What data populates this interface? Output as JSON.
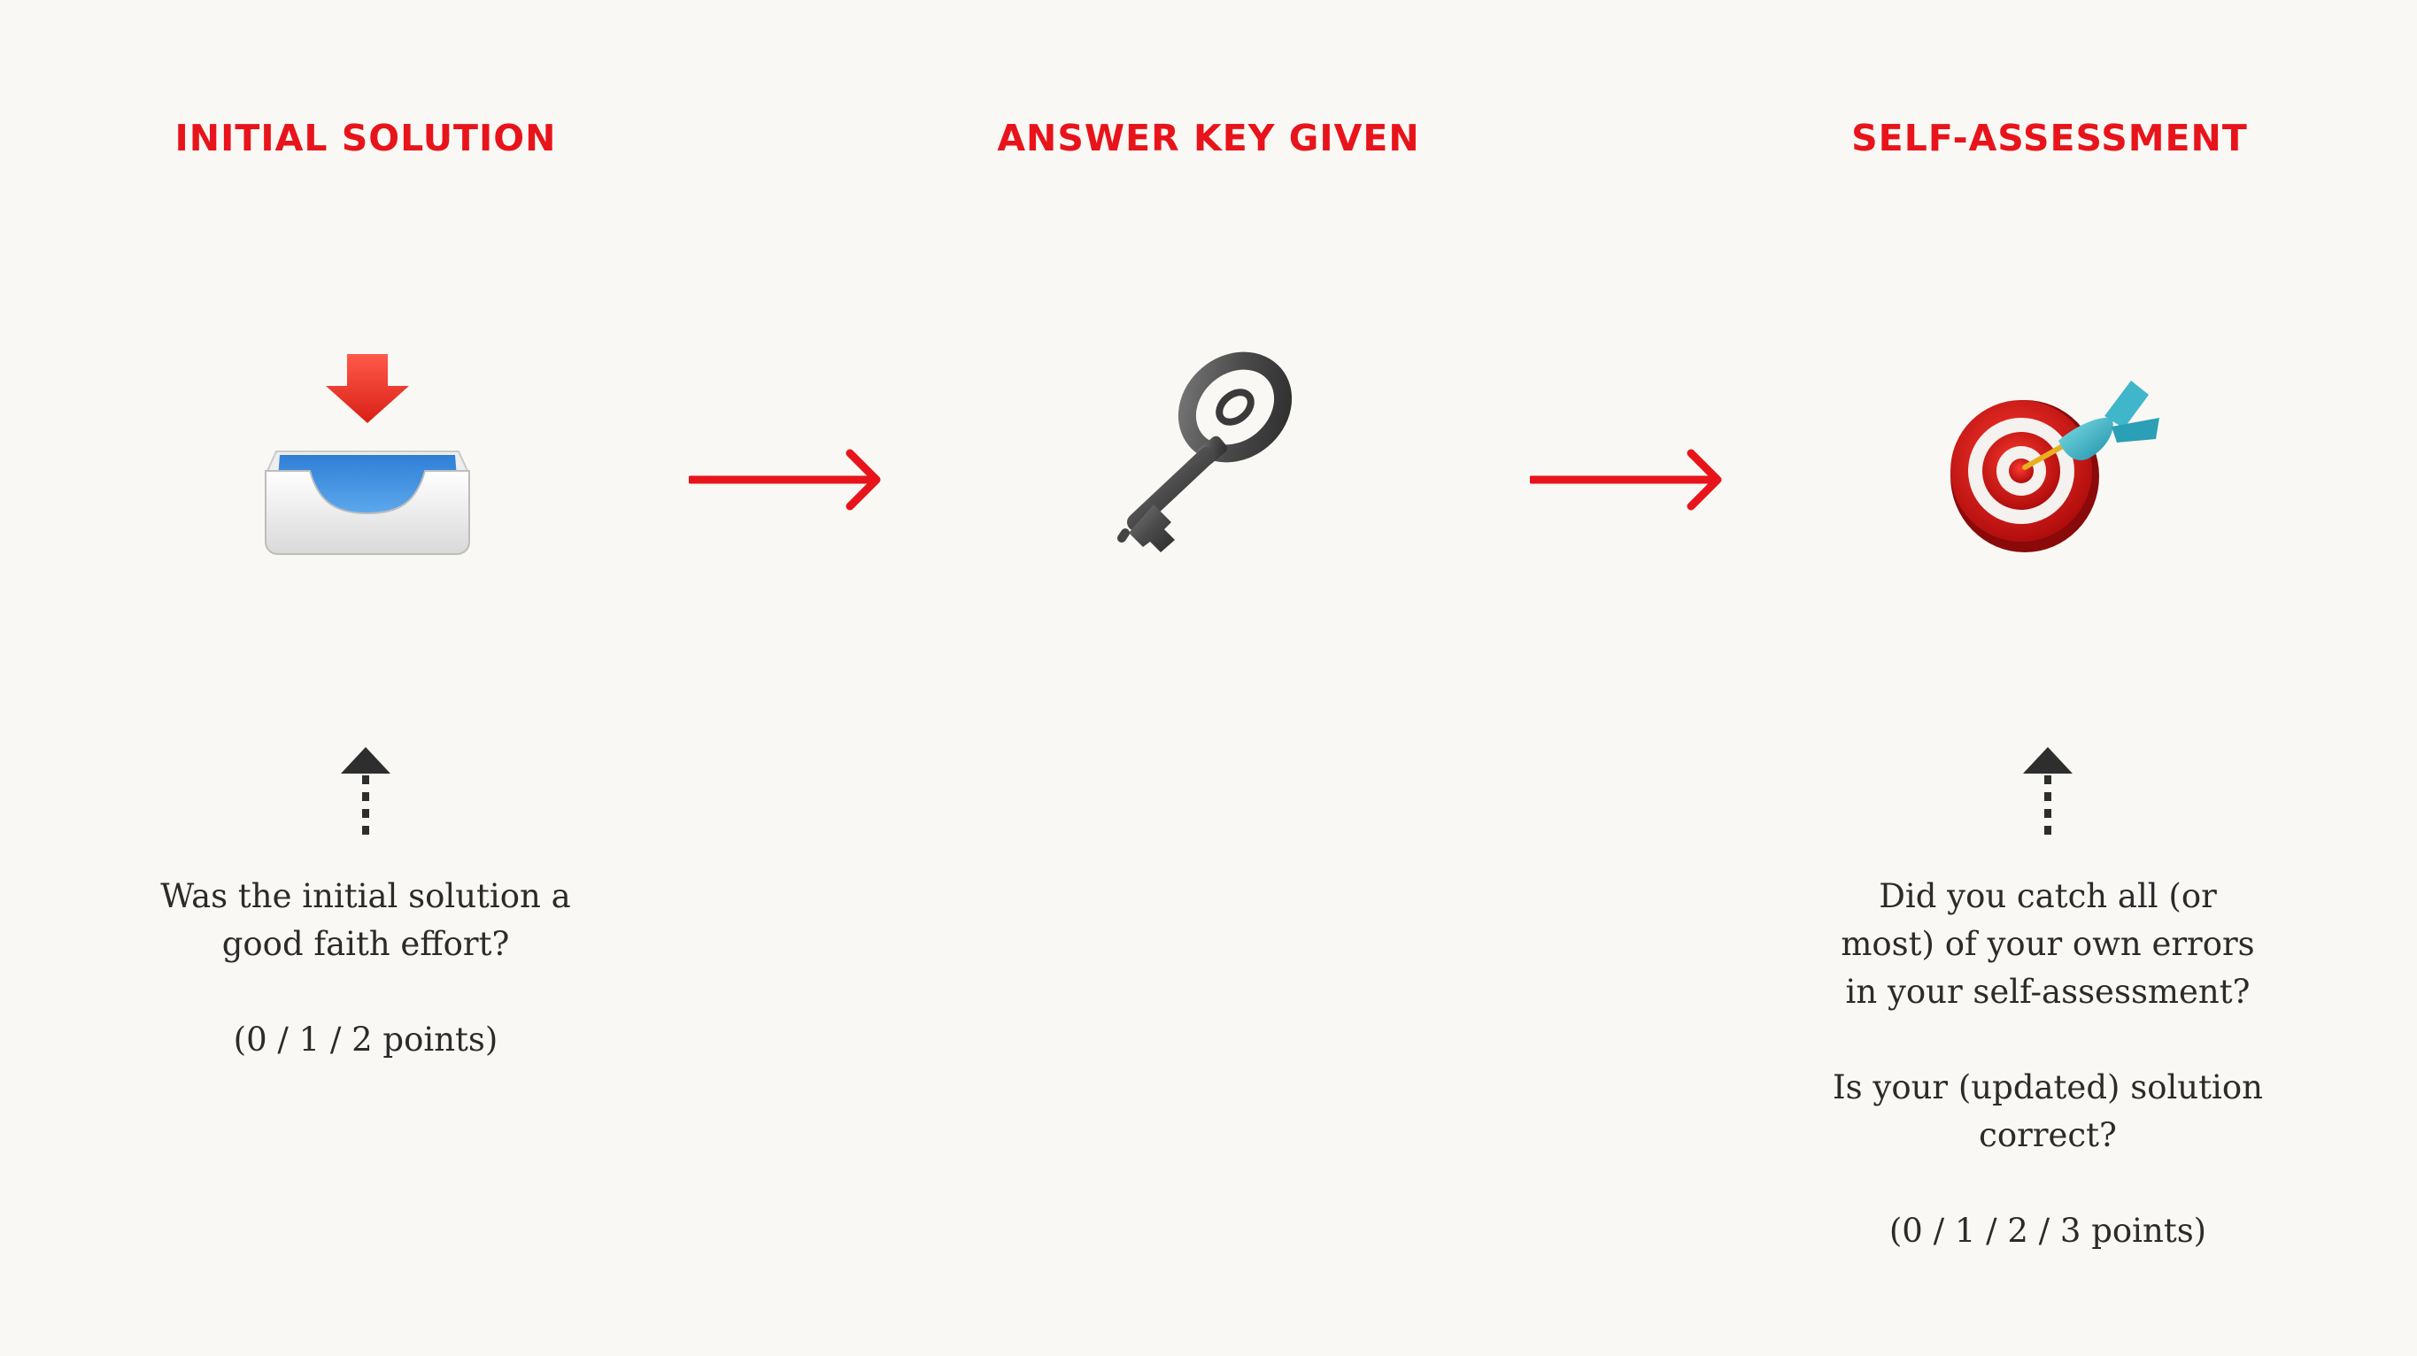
{
  "steps": [
    {
      "heading": "INITIAL SOLUTION",
      "icon": "inbox-tray-icon",
      "caption_lines": [
        "Was the initial solution a",
        "good faith effort?"
      ],
      "points": "(0 / 1 / 2 points)"
    },
    {
      "heading": "ANSWER KEY GIVEN",
      "icon": "old-key-icon"
    },
    {
      "heading": "SELF-ASSESSMENT",
      "icon": "bullseye-dart-icon",
      "caption_lines": [
        "Did you catch all (or",
        "most) of your own errors",
        "in your self-assessment?"
      ],
      "caption_lines_2": [
        "Is your (updated) solution",
        "correct?"
      ],
      "points": "(0 / 1 / 2 / 3 points)"
    }
  ],
  "colors": {
    "accent": "#e8141b",
    "background": "#f9f8f4",
    "text": "#2b2b2b",
    "dotted_arrow": "#2e2e2e"
  }
}
